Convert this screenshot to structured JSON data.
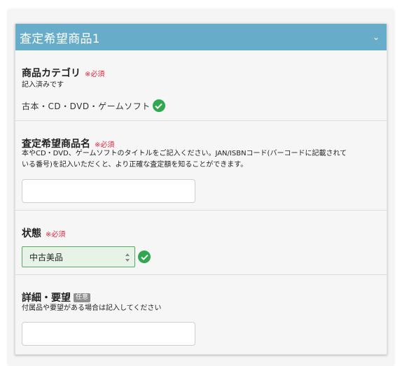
{
  "panel": {
    "title": "査定希望商品1"
  },
  "category": {
    "label": "商品カテゴリ",
    "required": "※必須",
    "help": "記入済みです",
    "value": "古本・CD・DVD・ゲームソフト"
  },
  "product_name": {
    "label": "査定希望商品名",
    "required": "※必須",
    "help_line1": "本やCD・DVD、ゲームソフトのタイトルをご記入ください。JAN/ISBNコード(バーコードに記載されて",
    "help_line2": "いる番号)を記入いただくと、より正確な査定額を知ることができます。",
    "value": ""
  },
  "condition": {
    "label": "状態",
    "required": "※必須",
    "selected": "中古美品"
  },
  "details": {
    "label": "詳細・要望",
    "optional": "任意",
    "help": "付属品や要望がある場合は記入してください",
    "value": ""
  },
  "colors": {
    "header": "#67acc9",
    "required": "#e0243a",
    "check": "#2fa84f",
    "select_bg": "#e7f3e7"
  }
}
